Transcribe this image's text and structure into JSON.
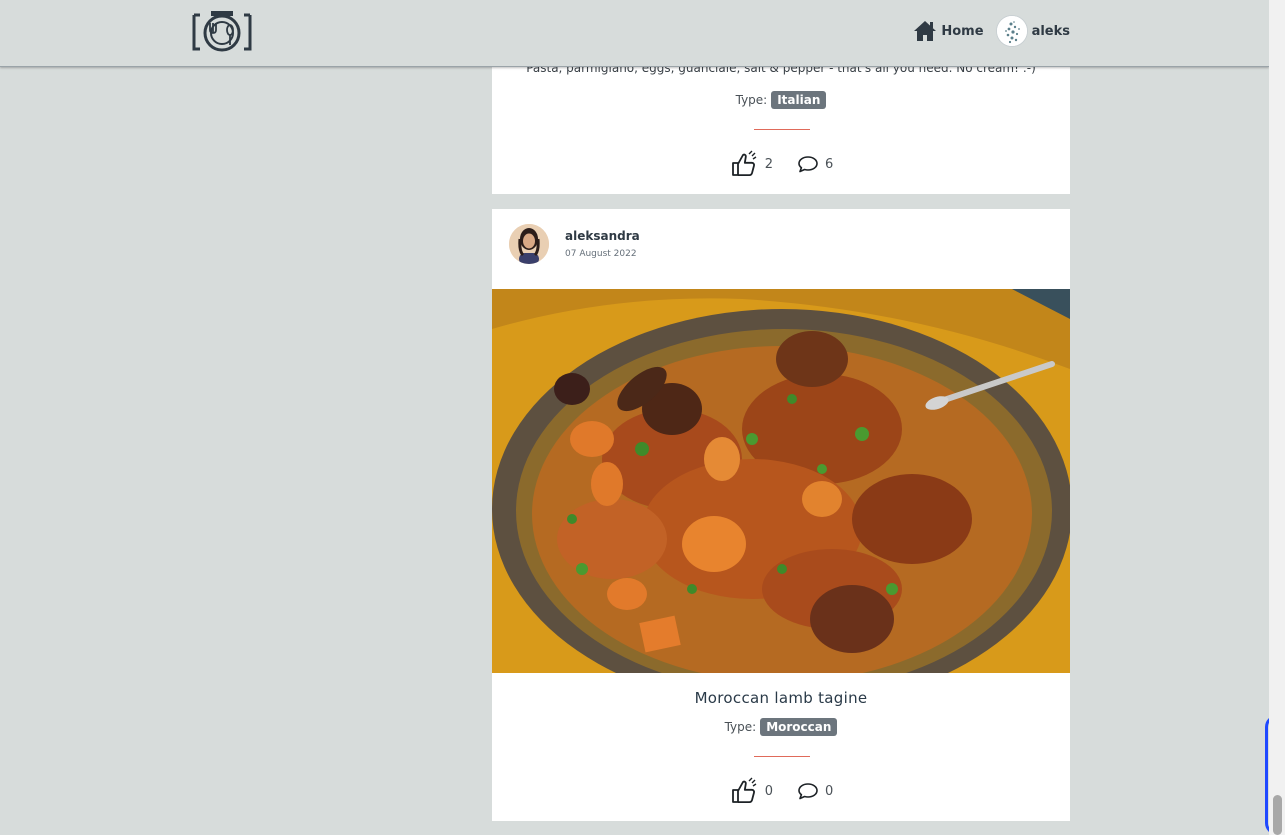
{
  "header": {
    "logo_icon": "camera-plate-logo-icon",
    "home_icon": "home-icon",
    "home_label": "Home",
    "user_name": "aleks"
  },
  "posts": [
    {
      "description": "Pasta, parmigiano, eggs, guanciale, salt & pepper - that's all you need. No cream! :-)",
      "type_label": "Type:",
      "type": "Italian",
      "likes": "2",
      "comments": "6"
    },
    {
      "author": "aleksandra",
      "date": "07 August 2022",
      "title": "Moroccan lamb tagine",
      "type_label": "Type:",
      "type": "Moroccan",
      "likes": "0",
      "comments": "0"
    }
  ],
  "colors": {
    "background": "#d7dcdb",
    "badge": "#6c757d",
    "divider": "#e06a5a",
    "scroll_ring": "#1f49ff"
  },
  "icons": {
    "like": "thumbs-up-icon",
    "comment": "comment-bubble-icon"
  }
}
